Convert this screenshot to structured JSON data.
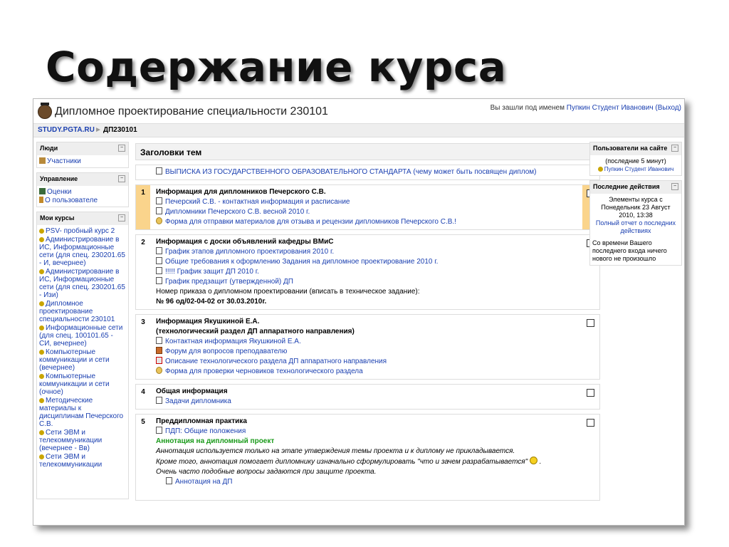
{
  "slide": {
    "title": "Содержание курса"
  },
  "header": {
    "site_title": "Дипломное проектирование специальности 230101",
    "login_prefix": "Вы зашли под именем ",
    "login_user": "Пупкин Студент Иванович",
    "logout": "(Выход)"
  },
  "breadcrumb": {
    "home": "STUDY.PGTA.RU",
    "separator": "►",
    "current": "ДП230101"
  },
  "left": {
    "people": {
      "title": "Люди",
      "items": [
        "Участники"
      ]
    },
    "admin": {
      "title": "Управление",
      "items": [
        "Оценки",
        "О пользователе"
      ]
    },
    "courses": {
      "title": "Мои курсы",
      "items": [
        "PSV- пробный курс 2",
        "Администрирование в ИС, Информационные сети (для спец. 230201.65 - И, вечернее)",
        "Администрирование в ИС, Информационные сети (для спец. 230201.65 - Изи)",
        "Дипломное проектирование специальности 230101",
        "Информационные сети (для спец. 100101.65 - СИ, вечернее)",
        "Компьютерные коммуникации и сети (вечернее)",
        "Компьютерные коммуникации и сети (очное)",
        "Методические материалы к дисциплинам Печерского С.В.",
        "Сети ЭВМ и телекоммуникации (вечернее - Вв)",
        "Сети ЭВМ и телекоммуникации"
      ]
    }
  },
  "main": {
    "heading": "Заголовки тем",
    "topic0": "ВЫПИСКА ИЗ ГОСУДАРСТВЕННОГО ОБРАЗОВАТЕЛЬНОГО СТАНДАРТА (чему может быть посвящен диплом)",
    "sections": [
      {
        "num": "1",
        "title": "Информация для дипломников Печерского С.В.",
        "items": [
          "Печерский С.В. - контактная информация и расписание",
          "Дипломники Печерского С.В. весной 2010 г.",
          "Форма для отправки материалов для отзыва и рецензии дипломников Печерского С.В.!"
        ]
      },
      {
        "num": "2",
        "title": "Информация с доски объявлений кафедры ВМиС",
        "items": [
          "График этапов дипломного проектирования 2010 г.",
          "Общие требования к оформлению Задания на дипломное проектирование 2010 г.",
          "!!!!! График защит ДП 2010 г.",
          "График предзащит (утвержденной) ДП"
        ],
        "note1": "Номер приказа о дипломном проектировании (вписать в техническое задание):",
        "note2": "№ 96 од/02-04-02 от 30.03.2010г."
      },
      {
        "num": "3",
        "title": "Информация Якушкиной Е.А.",
        "title2": "(технологический раздел ДП аппаратного направления)",
        "items": [
          "Контактная информация Якушкиной Е.А.",
          "Форум для вопросов преподавателю",
          "Описание технологического раздела ДП аппаратного направления",
          "Форма для проверки черновиков технологического раздела"
        ]
      },
      {
        "num": "4",
        "title": "Общая информация",
        "items": [
          "Задачи дипломника"
        ]
      },
      {
        "num": "5",
        "title": "Преддипломная практика",
        "items": [
          "ПДП: Общие положения"
        ],
        "annot_title": "Аннотация на дипломный проект",
        "annot_l1": "Аннотация используется только на этапе утверждения темы проекта и к диплому не прикладывается.",
        "annot_l2": "Кроме того, аннотация помогает дипломнику изначально сформулировать \"что и зачем разрабатывается\"",
        "annot_l3": "Очень часто подобные вопросы задаются при защите проекта.",
        "last_item": "Аннотация на ДП"
      }
    ]
  },
  "right": {
    "online": {
      "title": "Пользователи на сайте",
      "period": "(последние 5 минут)",
      "user": "Пупкин Студент Иванович"
    },
    "recent": {
      "title": "Последние действия",
      "line1": "Элементы курса с Понедельник 23 Август 2010, 13:38",
      "link": "Полный отчет о последних действиях",
      "line2": "Со времени Вашего последнего входа ничего нового не произошло"
    }
  }
}
